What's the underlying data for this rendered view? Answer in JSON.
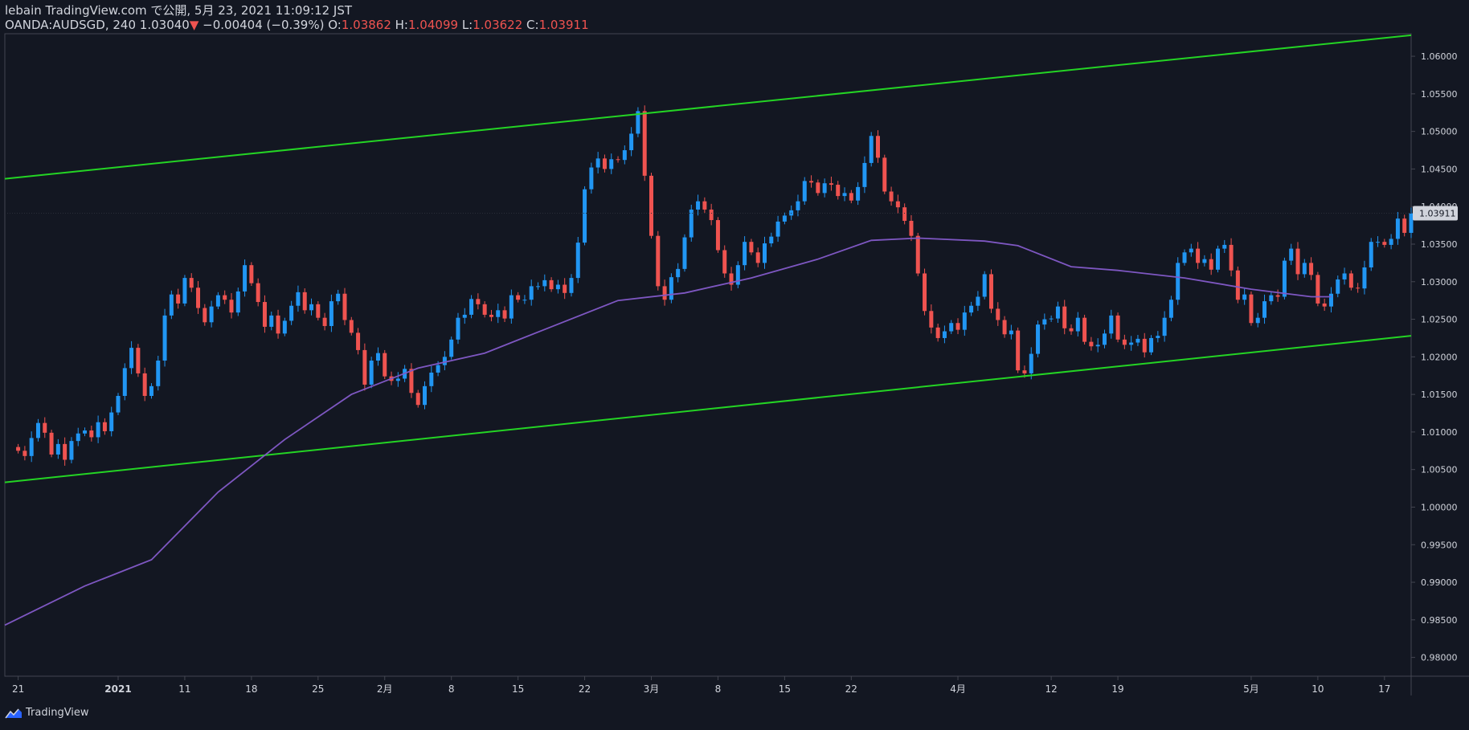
{
  "header": {
    "line1": "lebain TradingView.com で公開, 5月 23, 2021 11:09:12 JST",
    "symbol": "OANDA:AUDSGD, 240",
    "last": "1.03040",
    "arrow": "▼",
    "change": "−0.00404 (−0.39%)",
    "o_label": "O:",
    "o_value": "1.03862",
    "h_label": "H:",
    "h_value": "1.04099",
    "l_label": "L:",
    "l_value": "1.03622",
    "c_label": "C:",
    "c_value": "1.03911"
  },
  "footer": {
    "brand": "TradingView"
  },
  "colors": {
    "background": "#131722",
    "up": "#2196f3",
    "down": "#ef5350",
    "channel": "#24d424",
    "ma": "#7e57c2",
    "text": "#d1d4dc",
    "price_tag_bg": "#d1d4dc"
  },
  "chart_data": {
    "type": "candlestick",
    "symbol": "OANDA:AUDSGD",
    "timeframe": "240",
    "y_axis": {
      "range": [
        0.9775,
        1.063
      ],
      "ticks": [
        "1.06000",
        "1.05500",
        "1.05000",
        "1.04500",
        "1.04000",
        "1.03500",
        "1.03000",
        "1.02500",
        "1.02000",
        "1.01500",
        "1.01000",
        "1.00500",
        "1.00000",
        "0.99500",
        "0.99000",
        "0.98500",
        "0.98000"
      ],
      "last_price_label": "1.03911"
    },
    "x_axis": {
      "range": [
        -2,
        209
      ],
      "ticks": [
        {
          "t": 0,
          "label": "21"
        },
        {
          "t": 15,
          "label": "2021"
        },
        {
          "t": 25,
          "label": "11"
        },
        {
          "t": 35,
          "label": "18"
        },
        {
          "t": 45,
          "label": "25"
        },
        {
          "t": 55,
          "label": "2月"
        },
        {
          "t": 65,
          "label": "8"
        },
        {
          "t": 75,
          "label": "15"
        },
        {
          "t": 85,
          "label": "22"
        },
        {
          "t": 95,
          "label": "3月"
        },
        {
          "t": 105,
          "label": "8"
        },
        {
          "t": 115,
          "label": "15"
        },
        {
          "t": 125,
          "label": "22"
        },
        {
          "t": 141,
          "label": "4月"
        },
        {
          "t": 155,
          "label": "12"
        },
        {
          "t": 165,
          "label": "19"
        },
        {
          "t": 185,
          "label": "5月"
        },
        {
          "t": 195,
          "label": "10"
        },
        {
          "t": 205,
          "label": "17"
        }
      ]
    },
    "closes": [
      1.0075,
      1.0068,
      1.0092,
      1.0112,
      1.0099,
      1.007,
      1.0084,
      1.0063,
      1.0088,
      1.0098,
      1.0102,
      1.0093,
      1.0113,
      1.0101,
      1.0126,
      1.0148,
      1.0185,
      1.0212,
      1.0178,
      1.0148,
      1.0161,
      1.0195,
      1.0255,
      1.0283,
      1.0271,
      1.0305,
      1.0292,
      1.0265,
      1.0246,
      1.0267,
      1.0282,
      1.0276,
      1.0259,
      1.0287,
      1.0322,
      1.0298,
      1.0273,
      1.024,
      1.0255,
      1.0231,
      1.0248,
      1.0268,
      1.0286,
      1.0262,
      1.027,
      1.0252,
      1.0241,
      1.0274,
      1.0284,
      1.0249,
      1.0232,
      1.0209,
      1.0163,
      1.0195,
      1.0205,
      1.0174,
      1.0168,
      1.0171,
      1.0184,
      1.0152,
      1.0136,
      1.0161,
      1.0179,
      1.0189,
      1.02,
      1.0223,
      1.0252,
      1.0256,
      1.0277,
      1.027,
      1.0256,
      1.0253,
      1.0262,
      1.0251,
      1.0282,
      1.0276,
      1.0276,
      1.0294,
      1.0294,
      1.0302,
      1.029,
      1.0296,
      1.0285,
      1.0305,
      1.0352,
      1.0423,
      1.0452,
      1.0464,
      1.045,
      1.0463,
      1.0462,
      1.0475,
      1.0497,
      1.0527,
      1.0441,
      1.0361,
      1.0294,
      1.0276,
      1.0306,
      1.0317,
      1.0359,
      1.0396,
      1.0407,
      1.0396,
      1.0382,
      1.0342,
      1.0311,
      1.0296,
      1.0322,
      1.0353,
      1.0339,
      1.0325,
      1.0351,
      1.036,
      1.038,
      1.0388,
      1.0395,
      1.0407,
      1.0434,
      1.0432,
      1.0418,
      1.0431,
      1.0429,
      1.0414,
      1.0418,
      1.0408,
      1.0426,
      1.0458,
      1.0494,
      1.0465,
      1.042,
      1.0407,
      1.0399,
      1.0381,
      1.0361,
      1.0311,
      1.0261,
      1.0239,
      1.0225,
      1.0234,
      1.0245,
      1.0236,
      1.0259,
      1.0268,
      1.028,
      1.031,
      1.0264,
      1.0249,
      1.023,
      1.0235,
      1.0182,
      1.0178,
      1.0204,
      1.0243,
      1.025,
      1.0251,
      1.0267,
      1.0238,
      1.0234,
      1.0252,
      1.022,
      1.0214,
      1.0216,
      1.0231,
      1.0255,
      1.0223,
      1.0216,
      1.0219,
      1.0224,
      1.0206,
      1.0225,
      1.0228,
      1.0252,
      1.0276,
      1.0325,
      1.0339,
      1.0344,
      1.0325,
      1.033,
      1.0316,
      1.0344,
      1.0349,
      1.0315,
      1.0276,
      1.0283,
      1.0245,
      1.0252,
      1.0274,
      1.0282,
      1.028,
      1.0328,
      1.0344,
      1.031,
      1.0325,
      1.0309,
      1.0271,
      1.0267,
      1.0284,
      1.0303,
      1.0311,
      1.0292,
      1.0291,
      1.0319,
      1.0353,
      1.0353,
      1.0349,
      1.0357,
      1.0384,
      1.0365,
      1.0391
    ],
    "channel_upper": {
      "t0": -2,
      "v0": 1.0437,
      "t1": 209,
      "v1": 1.0628
    },
    "channel_lower": {
      "t0": -2,
      "v0": 1.0033,
      "t1": 209,
      "v1": 1.0228
    },
    "moving_average": [
      [
        -2,
        0.9843
      ],
      [
        10,
        0.9895
      ],
      [
        20,
        0.993
      ],
      [
        30,
        1.002
      ],
      [
        40,
        1.009
      ],
      [
        50,
        1.015
      ],
      [
        60,
        1.0185
      ],
      [
        70,
        1.0205
      ],
      [
        80,
        1.024
      ],
      [
        90,
        1.0275
      ],
      [
        100,
        1.0285
      ],
      [
        110,
        1.0305
      ],
      [
        120,
        1.033
      ],
      [
        128,
        1.0355
      ],
      [
        135,
        1.0358
      ],
      [
        145,
        1.0354
      ],
      [
        150,
        1.0348
      ],
      [
        158,
        1.032
      ],
      [
        165,
        1.0315
      ],
      [
        175,
        1.0305
      ],
      [
        185,
        1.029
      ],
      [
        194,
        1.028
      ],
      [
        197,
        1.028
      ]
    ]
  }
}
